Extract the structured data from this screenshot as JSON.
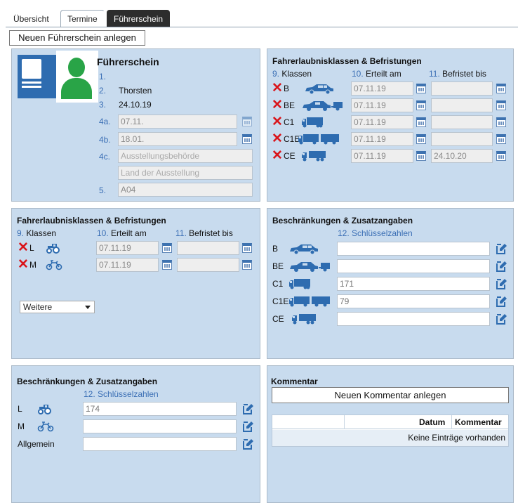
{
  "tabs": [
    "Übersicht",
    "Termine",
    "Führerschein"
  ],
  "new_license_button": "Neuen Führerschein anlegen",
  "license": {
    "title": "Führerschein",
    "n1": "1.",
    "n2": "2.",
    "v2": "Thorsten",
    "n3": "3.",
    "v3": "24.10.19",
    "n4a": "4a.",
    "v4a": "07.11.",
    "n4b": "4b.",
    "v4b": "18.01.",
    "n4c": "4c.",
    "v4c_placeholder": "Ausstellungsbehörde",
    "v4c2_placeholder": "Land der Ausstellung",
    "n5": "5.",
    "v5": "A04"
  },
  "classes1": {
    "title": "Fahrerlaubnisklassen & Befristungen",
    "h_classes": "9. Klassen",
    "h_issued": "10. Erteilt am",
    "h_expires": "11. Befristet bis",
    "rows": [
      {
        "code": "B",
        "issued": "07.11.19",
        "expires": ""
      },
      {
        "code": "BE",
        "issued": "07.11.19",
        "expires": ""
      },
      {
        "code": "C1",
        "issued": "07.11.19",
        "expires": ""
      },
      {
        "code": "C1E",
        "issued": "07.11.19",
        "expires": ""
      },
      {
        "code": "CE",
        "issued": "07.11.19",
        "expires": "24.10.20"
      }
    ]
  },
  "classes2": {
    "title": "Fahrerlaubnisklassen & Befristungen",
    "h_classes": "9. Klassen",
    "h_issued": "10. Erteilt am",
    "h_expires": "11. Befristet bis",
    "rows": [
      {
        "code": "L",
        "issued": "07.11.19",
        "expires": ""
      },
      {
        "code": "M",
        "issued": "07.11.19",
        "expires": ""
      }
    ],
    "more_select": "Weitere"
  },
  "restrictions1": {
    "title": "Beschränkungen & Zusatzangaben",
    "subtitle": "12. Schlüsselzahlen",
    "rows": [
      {
        "code": "B",
        "value": ""
      },
      {
        "code": "BE",
        "value": ""
      },
      {
        "code": "C1",
        "value": "171"
      },
      {
        "code": "C1E",
        "value": "79"
      },
      {
        "code": "CE",
        "value": ""
      }
    ]
  },
  "restrictions2": {
    "title": "Beschränkungen & Zusatzangaben",
    "subtitle": "12. Schlüsselzahlen",
    "rows": [
      {
        "code": "L",
        "value": "174"
      },
      {
        "code": "M",
        "value": ""
      },
      {
        "code": "Allgemein",
        "value": ""
      }
    ]
  },
  "comment": {
    "title": "Kommentar",
    "new_button": "Neuen Kommentar anlegen",
    "col_date": "Datum",
    "col_comment": "Kommentar",
    "empty": "Keine Einträge vorhanden"
  },
  "icons": {
    "calendar": "calendar-icon",
    "delete": "x-icon",
    "edit": "edit-icon",
    "avatar": "license-card-icon"
  },
  "colors": {
    "panel": "#c8dbee",
    "accent": "#3b6fb5",
    "delete": "#d9151b",
    "active_tab": "#2d2d2d"
  }
}
